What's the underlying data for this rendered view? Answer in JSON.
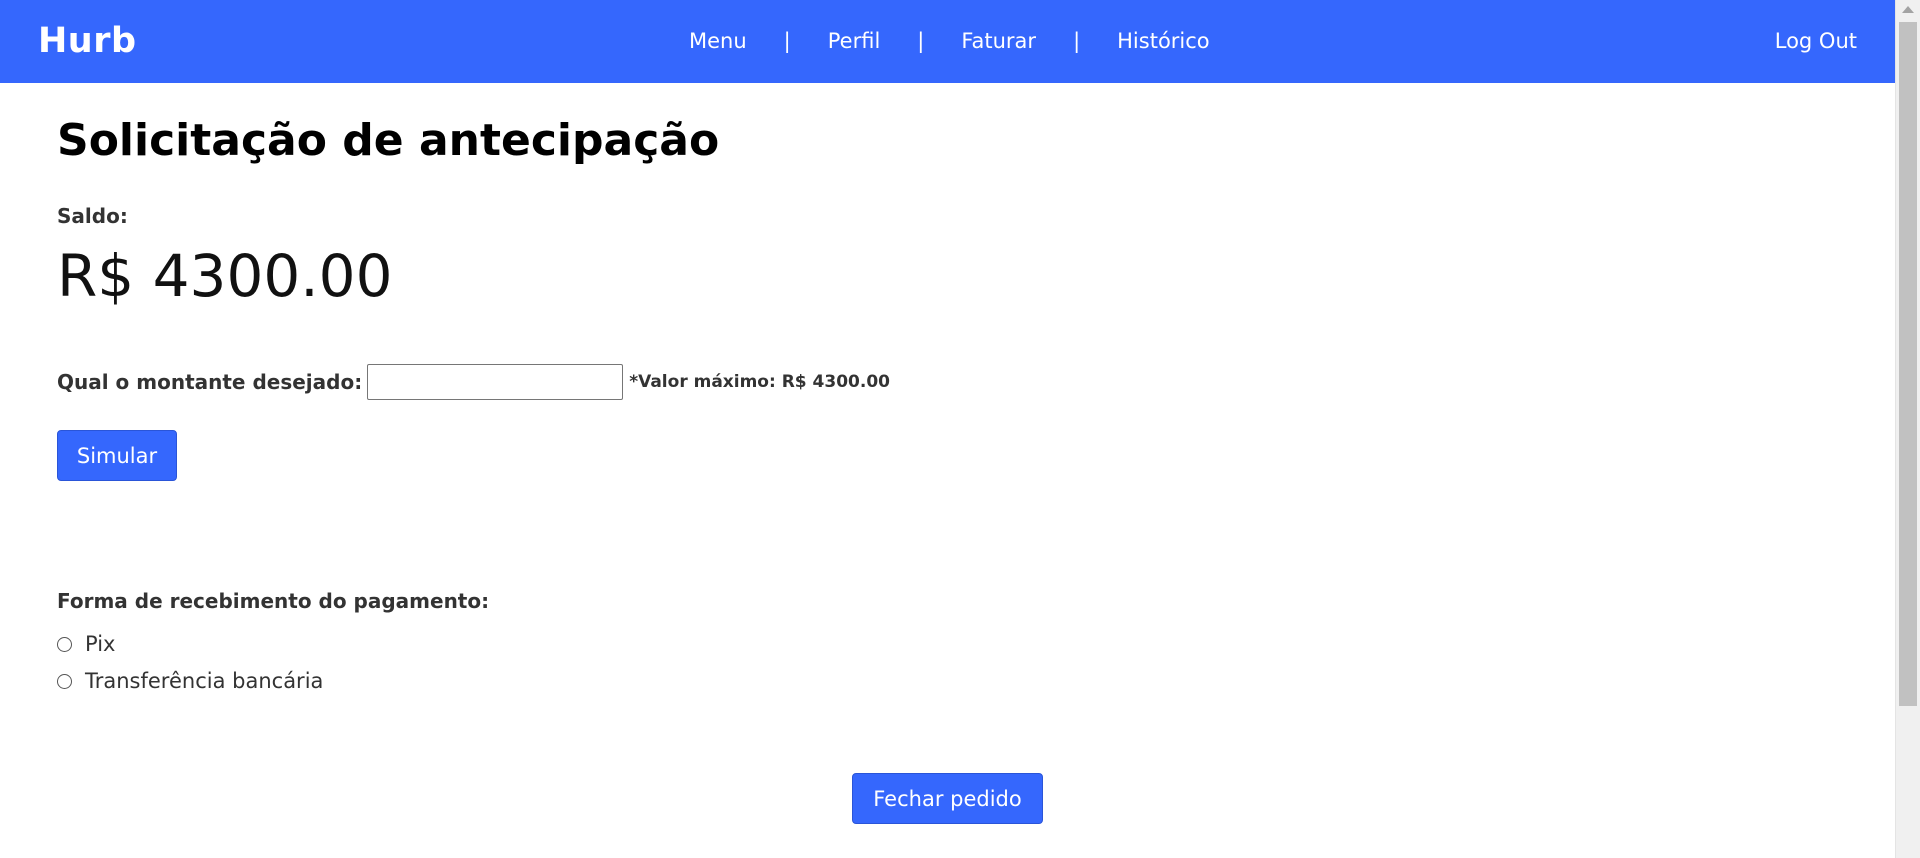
{
  "navbar": {
    "brand": "Hurb",
    "links": [
      "Menu",
      "Perfil",
      "Faturar",
      "Histórico"
    ],
    "separator": "|",
    "logout": "Log Out",
    "color": "#3567fd"
  },
  "main": {
    "title": "Solicitação de antecipação",
    "saldo_label": "Saldo:",
    "saldo_value": "R$ 4300.00",
    "amount_label": "Qual o montante desejado:",
    "amount_value": "",
    "amount_placeholder": "",
    "max_note": "*Valor máximo: R$ 4300.00",
    "simular_button": "Simular",
    "payment_label": "Forma de recebimento do pagamento:",
    "payment_options": [
      "Pix",
      "Transferência bancária"
    ],
    "submit_button": "Fechar pedido"
  }
}
